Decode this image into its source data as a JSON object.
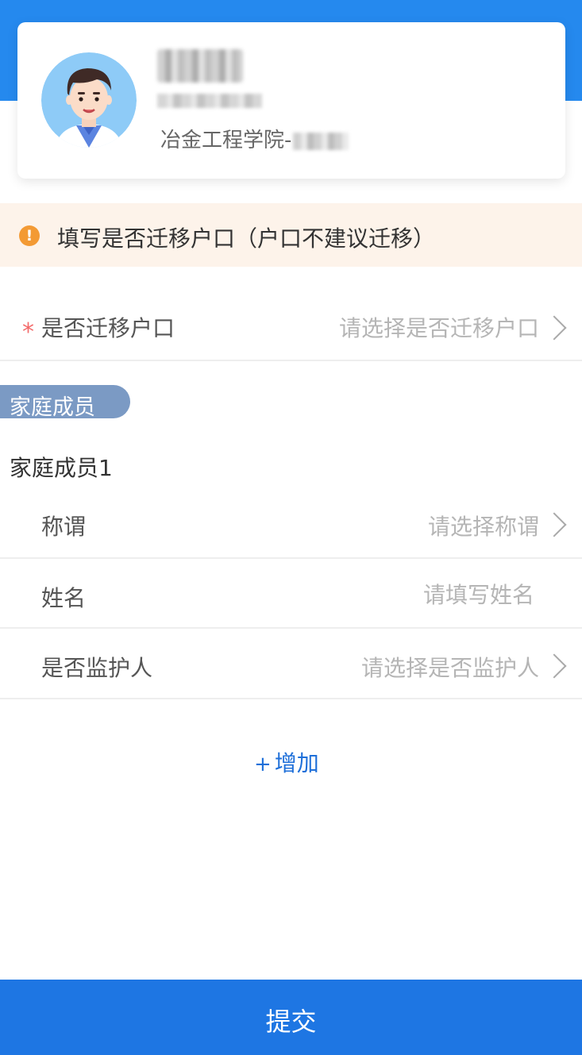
{
  "profile": {
    "college": "冶金工程学院-"
  },
  "notice": {
    "icon": "warning-icon",
    "text": "填写是否迁移户口（户口不建议迁移）",
    "color": "#f39a34"
  },
  "hukou": {
    "required_mark": "*",
    "label": "是否迁移户口",
    "placeholder": "请选择是否迁移户口"
  },
  "family": {
    "section_label": "家庭成员",
    "member_title": "家庭成员1",
    "fields": [
      {
        "label": "称谓",
        "placeholder": "请选择称谓"
      },
      {
        "label": "姓名",
        "placeholder": "请填写姓名"
      },
      {
        "label": "是否监护人",
        "placeholder": "请选择是否监护人"
      }
    ],
    "add_plus": "+",
    "add_label": "增加"
  },
  "submit": {
    "label": "提交"
  },
  "colors": {
    "brand_blue": "#2589ee",
    "submit_blue": "#1e76e3",
    "notice_bg": "#fdf3ea",
    "required_red": "#f36b6b",
    "section_pill": "#7b9ac4"
  }
}
